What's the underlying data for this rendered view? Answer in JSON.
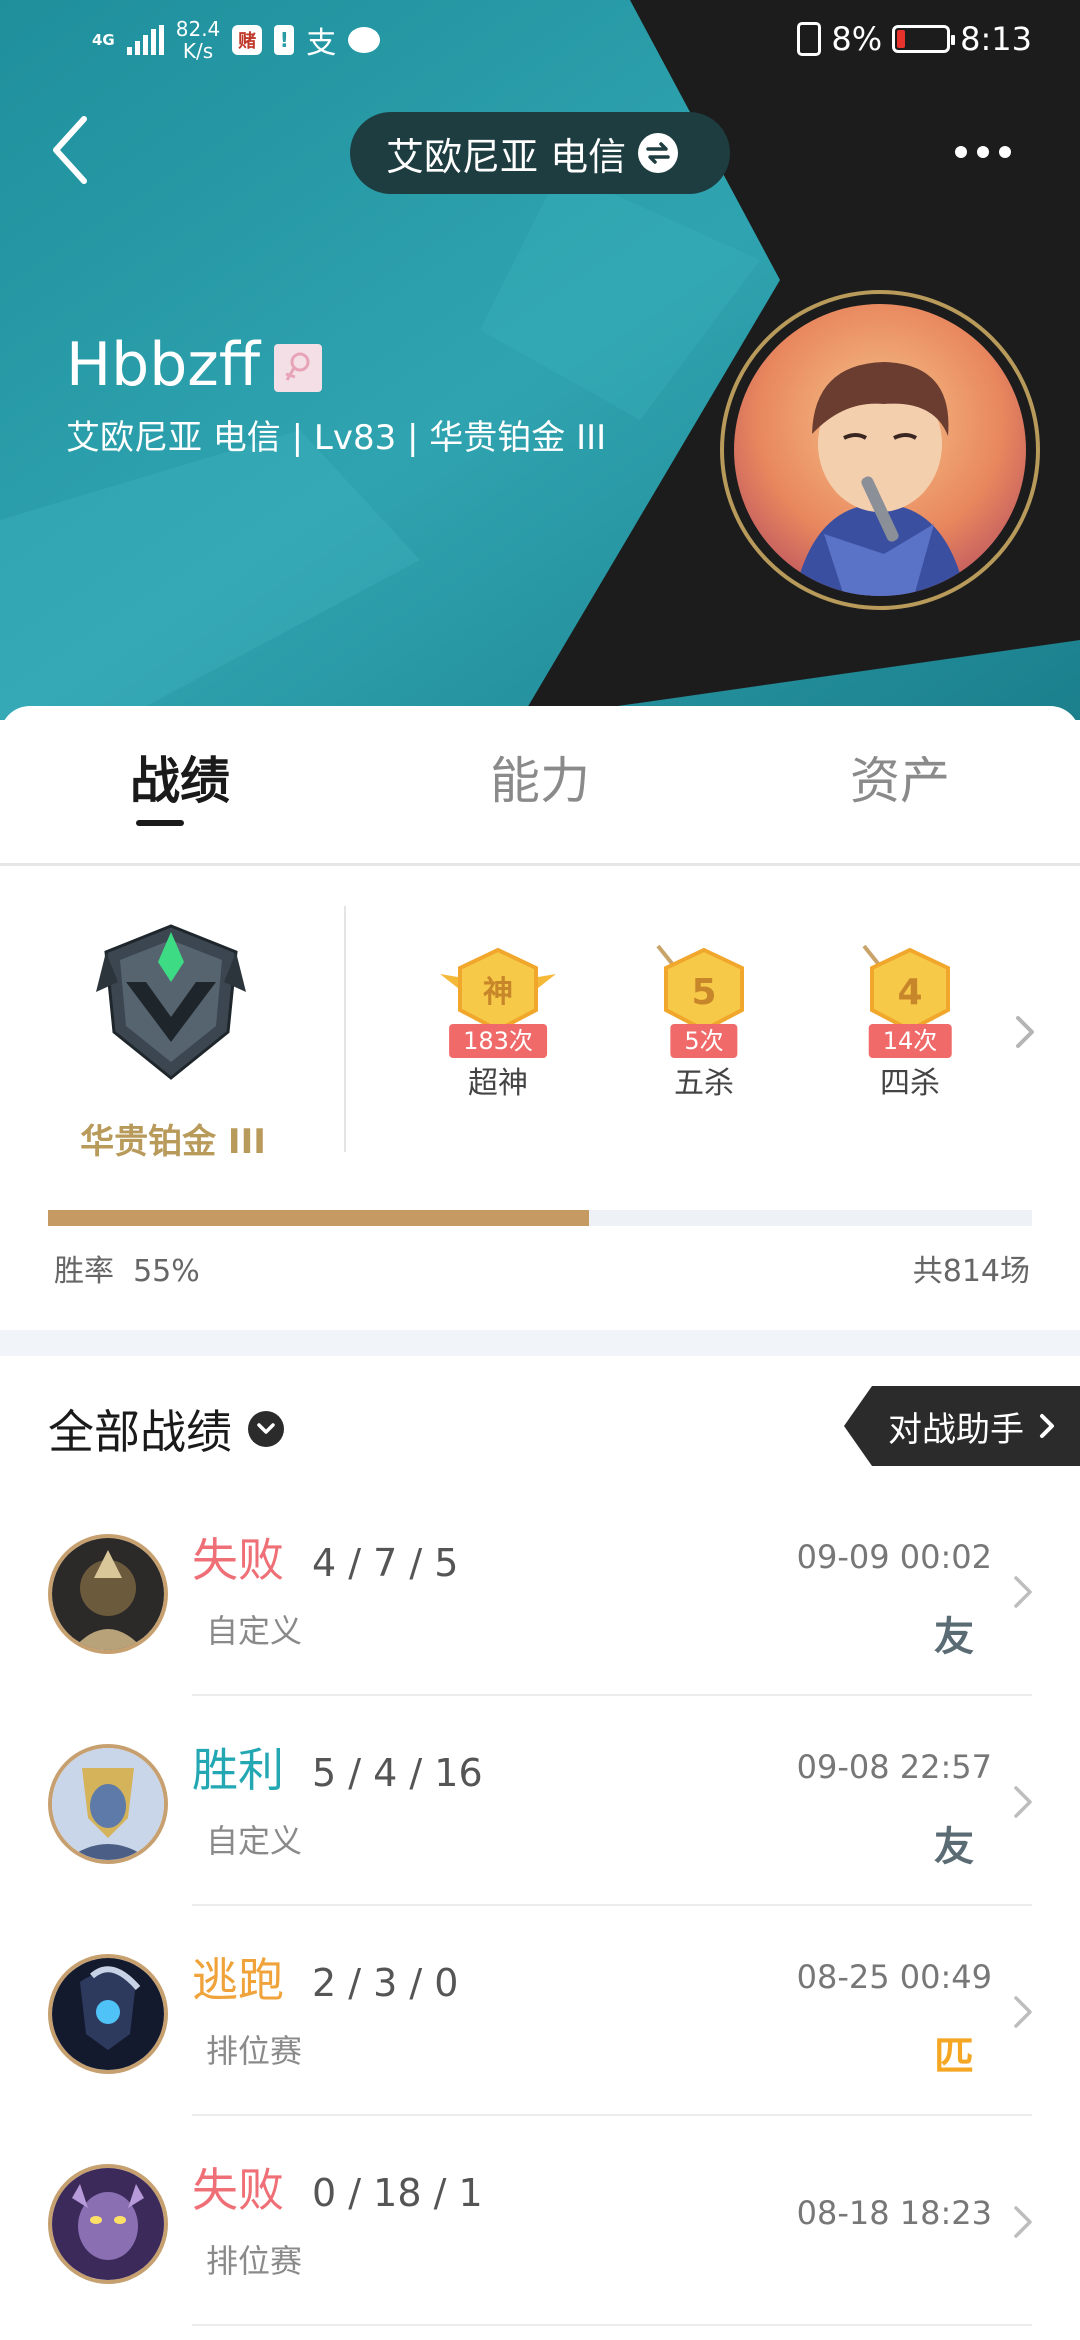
{
  "status_bar": {
    "network": "4G",
    "speed": "82.4",
    "speed_unit": "K/s",
    "app_icon_text": "赌",
    "alert_text": "!",
    "misc_glyph": "支",
    "battery": "8%",
    "time": "8:13"
  },
  "header": {
    "server": "艾欧尼亚 电信",
    "player_name": "Hbbzff",
    "gender_icon": "female-icon",
    "player_info": "艾欧尼亚 电信 | Lv83 | 华贵铂金 III"
  },
  "tabs": [
    {
      "label": "战绩",
      "active": true
    },
    {
      "label": "能力",
      "active": false
    },
    {
      "label": "资产",
      "active": false
    }
  ],
  "rank": {
    "name": "华贵铂金 III"
  },
  "medals": [
    {
      "icon_text": "神",
      "count": "183次",
      "label": "超神"
    },
    {
      "icon_text": "5",
      "count": "5次",
      "label": "五杀"
    },
    {
      "icon_text": "4",
      "count": "14次",
      "label": "四杀"
    }
  ],
  "win": {
    "rate_label": "胜率",
    "rate_value": "55%",
    "rate_fraction": 0.55,
    "total": "共814场"
  },
  "history": {
    "title": "全部战绩",
    "assist_button": "对战助手",
    "matches": [
      {
        "result": "失败",
        "result_type": "lose",
        "kda": "4 / 7 / 5",
        "mode": "自定义",
        "time": "09-09 00:02",
        "tag": "友",
        "tag_type": "friend",
        "hero_color": "#6b5a3c"
      },
      {
        "result": "胜利",
        "result_type": "win",
        "kda": "5 / 4 / 16",
        "mode": "自定义",
        "time": "09-08 22:57",
        "tag": "友",
        "tag_type": "friend",
        "hero_color": "#5d7aa8"
      },
      {
        "result": "逃跑",
        "result_type": "flee",
        "kda": "2 / 3 / 0",
        "mode": "排位赛",
        "time": "08-25 00:49",
        "tag": "匹",
        "tag_type": "rank",
        "hero_color": "#2d3a5e"
      },
      {
        "result": "失败",
        "result_type": "lose",
        "kda": "0 / 18 / 1",
        "mode": "排位赛",
        "time": "08-18 18:23",
        "tag": "",
        "tag_type": "none",
        "hero_color": "#8b6fb3"
      }
    ]
  },
  "colors": {
    "teal": "#2a9ca8",
    "gold": "#b89a5b",
    "lose": "#ef6f77",
    "win": "#22a7b3",
    "flee": "#f0a33a"
  }
}
